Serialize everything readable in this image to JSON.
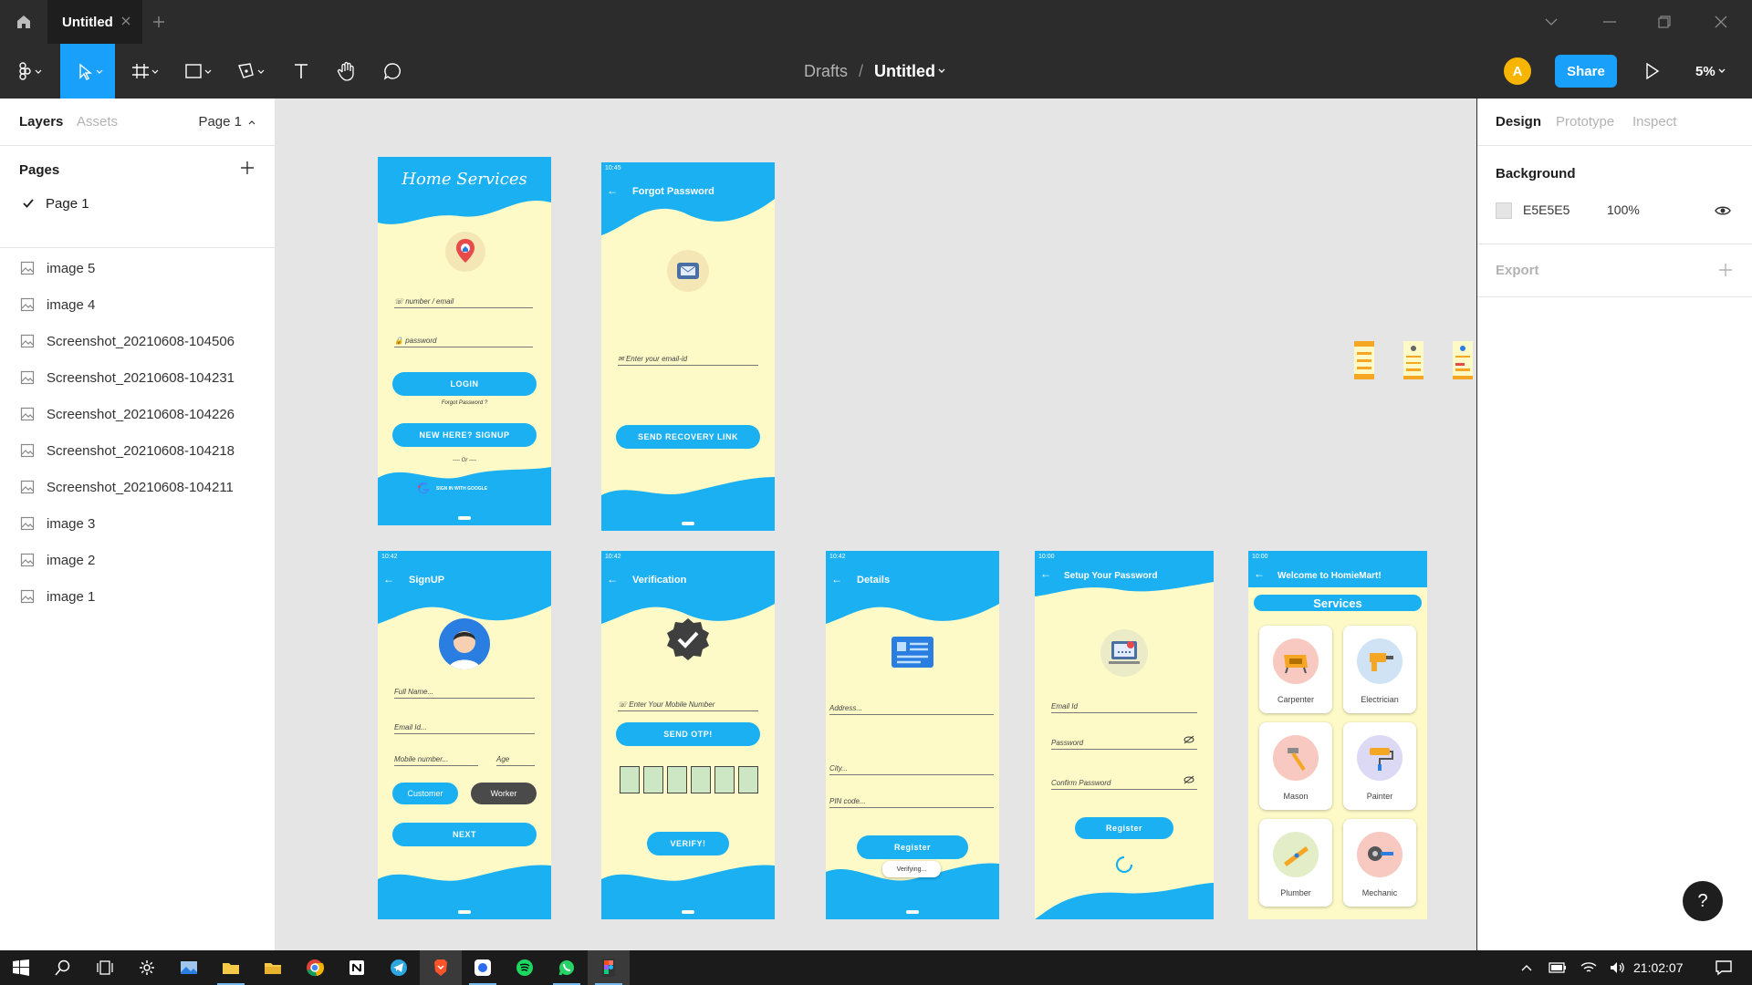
{
  "window": {
    "tab_title": "Untitled"
  },
  "toolbar": {
    "breadcrumb_folder": "Drafts",
    "breadcrumb_sep": "/",
    "file_name": "Untitled",
    "avatar_initial": "A",
    "share_label": "Share",
    "zoom": "5%"
  },
  "left_panel": {
    "tab_layers": "Layers",
    "tab_assets": "Assets",
    "page_selector": "Page 1",
    "pages_title": "Pages",
    "current_page": "Page 1",
    "layers": [
      "image 5",
      "image 4",
      "Screenshot_20210608-104506",
      "Screenshot_20210608-104231",
      "Screenshot_20210608-104226",
      "Screenshot_20210608-104218",
      "Screenshot_20210608-104211",
      "image 3",
      "image 2",
      "image 1"
    ]
  },
  "right_panel": {
    "tab_design": "Design",
    "tab_prototype": "Prototype",
    "tab_inspect": "Inspect",
    "background_title": "Background",
    "bg_hex": "E5E5E5",
    "bg_opacity": "100%",
    "export_title": "Export"
  },
  "screens": {
    "home": {
      "title": "Home Services",
      "field1": "number / email",
      "field2": "password",
      "login": "LOGIN",
      "forgot": "Forgot Password ?",
      "new_here": "NEW HERE?   SIGNUP",
      "or": "---- Or ----",
      "google": "SIGN IN WITH GOOGLE"
    },
    "forgot": {
      "title": "Forgot Password",
      "field": "Enter your email-id",
      "button": "SEND RECOVERY LINK"
    },
    "signup": {
      "title": "SignUP",
      "full_name": "Full Name...",
      "email": "Email Id...",
      "mobile": "Mobile number...",
      "age": "Age",
      "customer": "Customer",
      "worker": "Worker",
      "next": "NEXT"
    },
    "verify": {
      "title": "Verification",
      "field": "Enter Your Mobile Number",
      "send_otp": "SEND OTP!",
      "verify": "VERIFY!"
    },
    "details": {
      "title": "Details",
      "address": "Address...",
      "city": "City...",
      "pin": "PIN code...",
      "register": "Register",
      "verifying": "Verifying..."
    },
    "setup": {
      "title": "Setup Your Password",
      "email": "Email Id",
      "password": "Password",
      "confirm": "Confirm Password",
      "register": "Register"
    },
    "services": {
      "title": "Welcome to HomieMart!",
      "heading": "Services",
      "items": [
        "Carpenter",
        "Electrician",
        "Mason",
        "Painter",
        "Plumber",
        "Mechanic"
      ]
    }
  },
  "status_times": {
    "a": "10:45",
    "b": "10:42",
    "c": "10:00"
  },
  "taskbar": {
    "clock": "21:02:07"
  },
  "colors": {
    "accent": "#18a0fb",
    "screen_blue": "#1ab0f2",
    "screen_cream": "#fdfac8"
  }
}
